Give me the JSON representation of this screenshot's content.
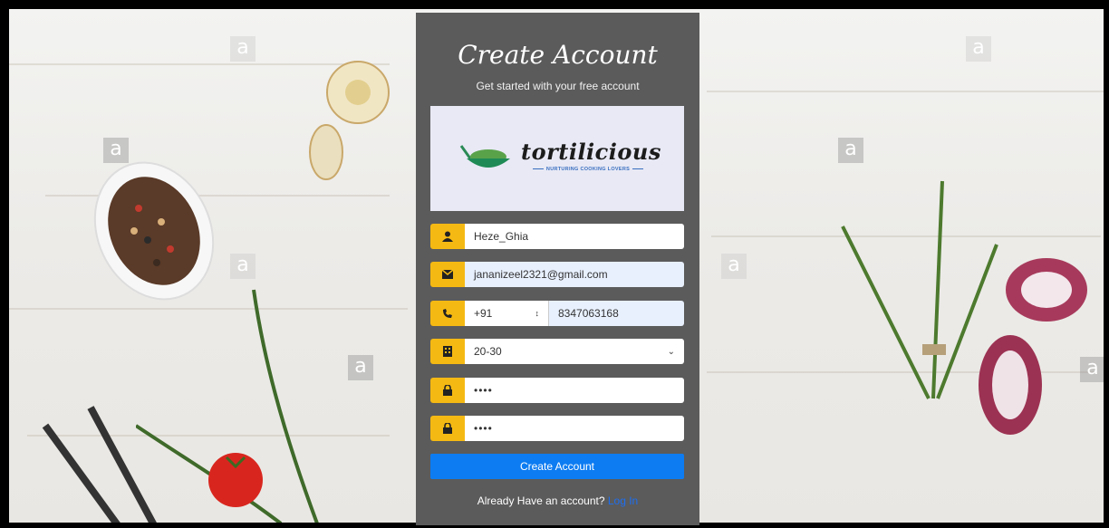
{
  "card": {
    "title": "Create Account",
    "subtitle": "Get started with your free account"
  },
  "logo": {
    "name": "tortilicious",
    "tagline": "NURTURING COOKING LOVERS"
  },
  "form": {
    "username": "Heze_Ghia",
    "email": "jananizeel2321@gmail.com",
    "country_code": "+91",
    "phone": "8347063168",
    "age_range": "20-30",
    "password": "••••",
    "confirm_password": "••••",
    "submit_label": "Create Account"
  },
  "footer": {
    "prompt": "Already Have an account?",
    "login_label": "Log In"
  },
  "watermarks": [
    "a",
    "a",
    "a",
    "a",
    "a",
    "a",
    "a",
    "a"
  ],
  "colors": {
    "accent": "#f5b913",
    "primary_button": "#0d7cf2",
    "card_bg": "#5b5b5b",
    "link": "#1d6ef0"
  },
  "icons": [
    "user-icon",
    "envelope-icon",
    "phone-icon",
    "building-icon",
    "lock-icon",
    "lock-icon"
  ]
}
